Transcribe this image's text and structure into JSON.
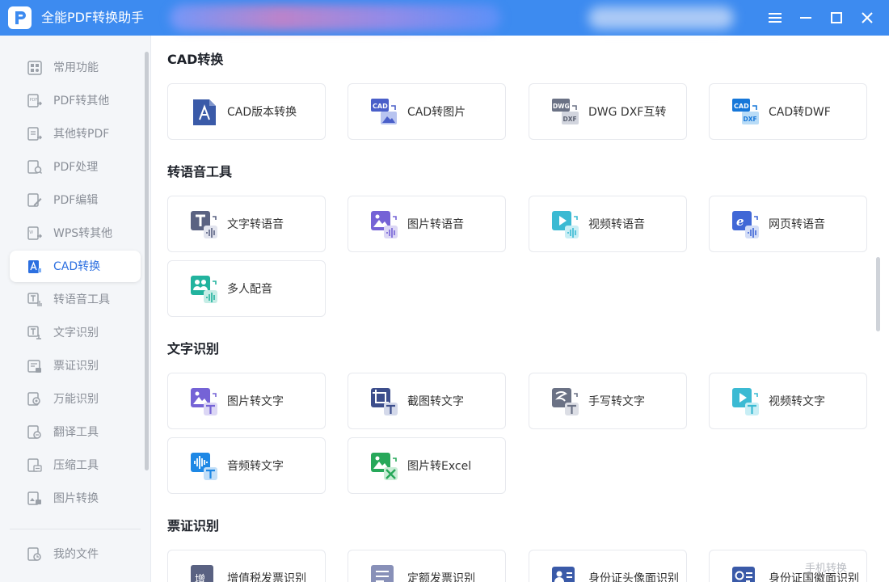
{
  "app": {
    "title": "全能PDF转换助手"
  },
  "sidebar": {
    "items": [
      {
        "label": "常用功能",
        "icon": "common-functions-icon"
      },
      {
        "label": "PDF转其他",
        "icon": "pdf-to-other-icon"
      },
      {
        "label": "其他转PDF",
        "icon": "other-to-pdf-icon"
      },
      {
        "label": "PDF处理",
        "icon": "pdf-process-icon"
      },
      {
        "label": "PDF编辑",
        "icon": "pdf-edit-icon"
      },
      {
        "label": "WPS转其他",
        "icon": "wps-to-other-icon"
      },
      {
        "label": "CAD转换",
        "icon": "cad-convert-icon",
        "active": true
      },
      {
        "label": "转语音工具",
        "icon": "text-to-speech-icon"
      },
      {
        "label": "文字识别",
        "icon": "text-recognition-icon"
      },
      {
        "label": "票证识别",
        "icon": "ticket-recognition-icon"
      },
      {
        "label": "万能识别",
        "icon": "universal-recognition-icon"
      },
      {
        "label": "翻译工具",
        "icon": "translate-icon"
      },
      {
        "label": "压缩工具",
        "icon": "compress-icon"
      },
      {
        "label": "图片转换",
        "icon": "image-convert-icon"
      }
    ],
    "footer_item": {
      "label": "我的文件",
      "icon": "my-files-icon"
    }
  },
  "sections": [
    {
      "title": "CAD转换",
      "cards": [
        {
          "label": "CAD版本转换",
          "icon": "cad-version-icon"
        },
        {
          "label": "CAD转图片",
          "icon": "cad-to-image-icon"
        },
        {
          "label": "DWG DXF互转",
          "icon": "dwg-dxf-icon"
        },
        {
          "label": "CAD转DWF",
          "icon": "cad-to-dwf-icon"
        }
      ]
    },
    {
      "title": "转语音工具",
      "cards": [
        {
          "label": "文字转语音",
          "icon": "text-to-voice-icon"
        },
        {
          "label": "图片转语音",
          "icon": "image-to-voice-icon"
        },
        {
          "label": "视频转语音",
          "icon": "video-to-voice-icon"
        },
        {
          "label": "网页转语音",
          "icon": "web-to-voice-icon"
        },
        {
          "label": "多人配音",
          "icon": "multi-voice-icon"
        }
      ]
    },
    {
      "title": "文字识别",
      "cards": [
        {
          "label": "图片转文字",
          "icon": "image-to-text-icon"
        },
        {
          "label": "截图转文字",
          "icon": "screenshot-to-text-icon"
        },
        {
          "label": "手写转文字",
          "icon": "handwriting-to-text-icon"
        },
        {
          "label": "视频转文字",
          "icon": "video-to-text-icon"
        },
        {
          "label": "音频转文字",
          "icon": "audio-to-text-icon"
        },
        {
          "label": "图片转Excel",
          "icon": "image-to-excel-icon"
        }
      ]
    },
    {
      "title": "票证识别",
      "cards": [
        {
          "label": "增值税发票识别",
          "icon": "vat-invoice-icon"
        },
        {
          "label": "定额发票识别",
          "icon": "quota-invoice-icon"
        },
        {
          "label": "身份证头像面识别",
          "icon": "id-front-icon"
        },
        {
          "label": "身份证国徽面识别",
          "icon": "id-back-icon"
        }
      ]
    }
  ],
  "watermark": "手机转换",
  "colors": {
    "titlebar": "#3d8bf0",
    "accent": "#2c6fe0",
    "sidebar_bg": "#f4f6f9"
  }
}
